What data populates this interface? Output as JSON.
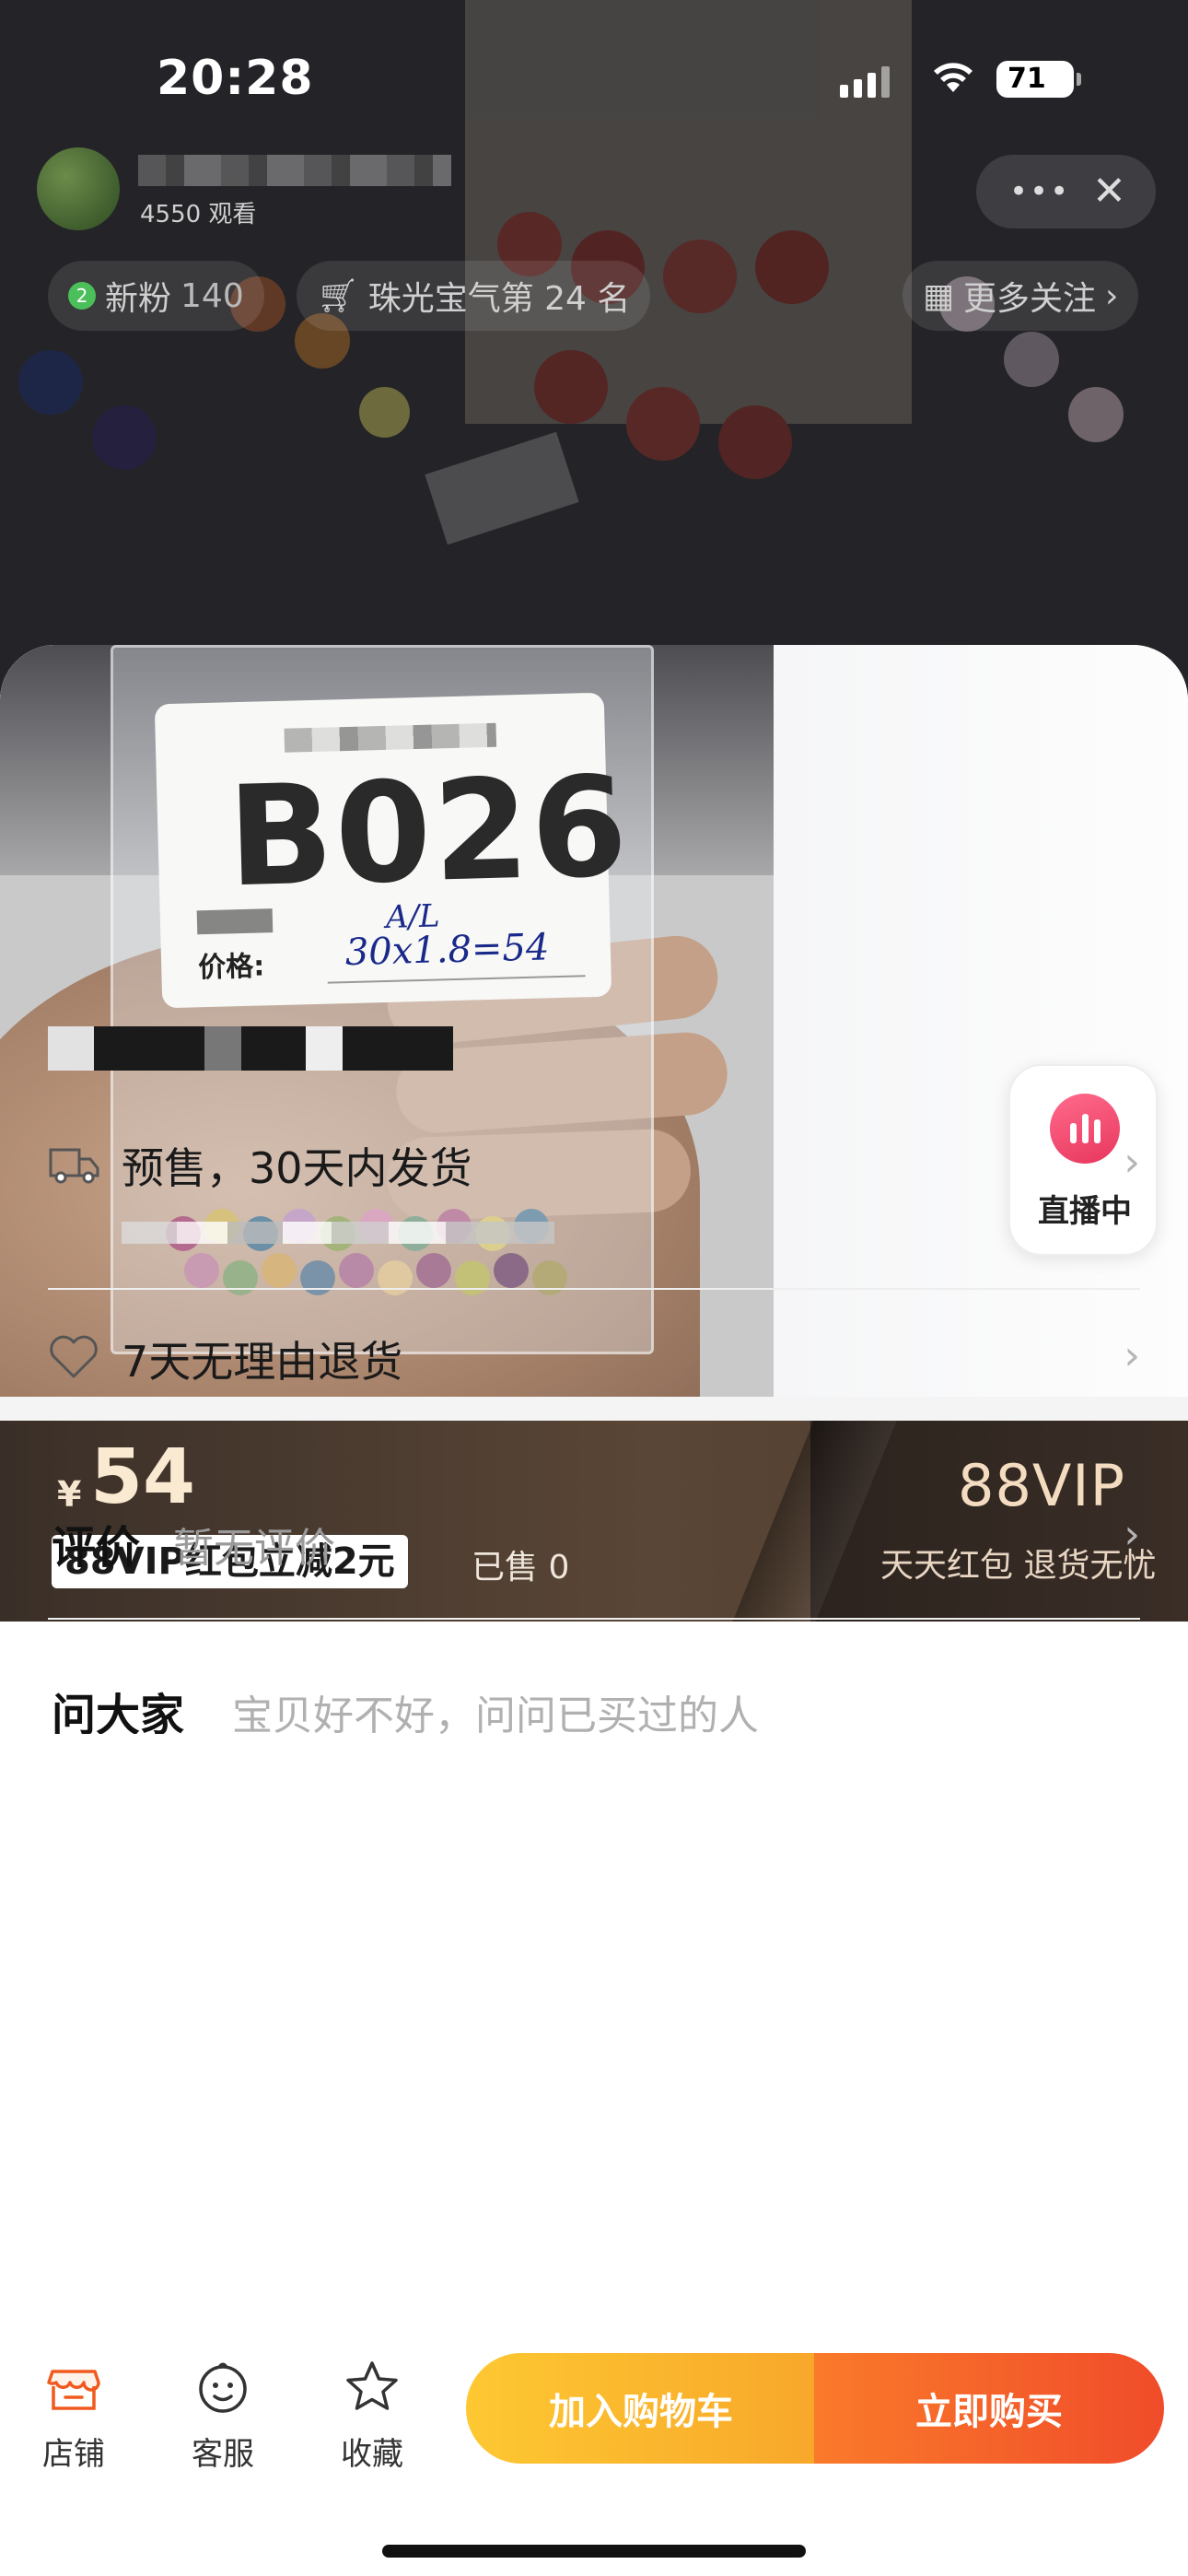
{
  "status": {
    "time": "20:28",
    "battery": "71"
  },
  "stream": {
    "viewers": "4550 观看",
    "new_fans_label": "新粉",
    "new_fans_count": "140",
    "rank_text": "珠光宝气第 24 名",
    "more_follow": "更多关注"
  },
  "gallery": {
    "product_code": "B026",
    "price_label": "价格:",
    "handwritten_top": "A/L",
    "handwritten_price": "30x1.8=54",
    "live_badge": "直播中"
  },
  "price_band": {
    "currency": "¥",
    "price": "54",
    "coupon": "88VIP红包立减2元",
    "sold": "已售 0",
    "vip_title": "88VIP",
    "vip_sub": "天天红包 退货无忧"
  },
  "info": {
    "shipping": "预售，30天内发货",
    "returns": "7天无理由退货"
  },
  "reviews": {
    "label": "评价",
    "empty": "暂无评价"
  },
  "ask": {
    "label": "问大家",
    "hint": "宝贝好不好，问问已买过的人"
  },
  "bottom_bar": {
    "tabs": [
      {
        "label": "店铺",
        "icon": "store-icon"
      },
      {
        "label": "客服",
        "icon": "customer-service-icon"
      },
      {
        "label": "收藏",
        "icon": "star-icon"
      }
    ],
    "add_to_cart": "加入购物车",
    "buy_now": "立即购买"
  },
  "colors": {
    "accent_orange": "#f04c2a",
    "accent_yellow": "#fdc832",
    "price_gold": "#fbead2",
    "live_pink": "#e8365e"
  }
}
